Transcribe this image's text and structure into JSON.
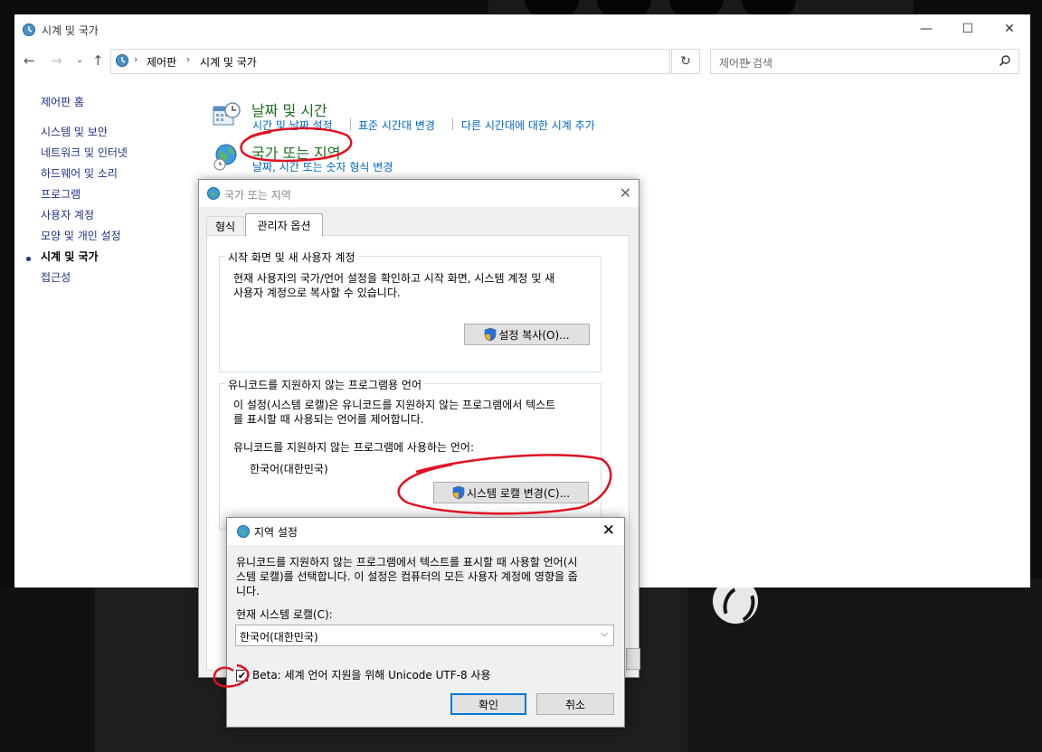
{
  "window": {
    "title": "시계 및 국가",
    "buttons": {
      "minimize": "—",
      "maximize": "☐",
      "close": "✕"
    }
  },
  "address": {
    "crumbs": [
      "제어판",
      "시계 및 국가"
    ],
    "search_placeholder": "제어판 검색"
  },
  "sidebar": {
    "home": "제어판 홈",
    "items": [
      "시스템 및 보안",
      "네트워크 및 인터넷",
      "하드웨어 및 소리",
      "프로그램",
      "사용자 계정",
      "모양 및 개인 설정",
      "시계 및 국가",
      "접근성"
    ]
  },
  "categories": {
    "datetime": {
      "title": "날짜 및 시간",
      "links": [
        "시간 및 날짜 설정",
        "표준 시간대 변경",
        "다른 시간대에 대한 시계 추가"
      ]
    },
    "region": {
      "title": "국가 또는 지역",
      "links": [
        "날짜, 시간 또는 숫자 형식 변경"
      ]
    }
  },
  "region_dialog": {
    "title": "국가 또는 지역",
    "tabs": [
      "형식",
      "관리자 옵션"
    ],
    "welcome": {
      "title": "시작 화면 및 새 사용자 계정",
      "text1": "현재 사용자의 국가/언어 설정을 확인하고 시작 화면, 시스템 계정 및 새",
      "text2": "사용자 계정으로 복사할 수 있습니다.",
      "button": "설정 복사(O)..."
    },
    "unicode": {
      "title": "유니코드를 지원하지 않는 프로그램용 언어",
      "text1": "이 설정(시스템 로캘)은 유니코드를 지원하지 않는 프로그램에서 텍스트",
      "text2": "를 표시할 때 사용되는 언어를 제어합니다.",
      "label": "유니코드를 지원하지 않는 프로그램에 사용하는 언어:",
      "current": "한국어(대한민국)",
      "button": "시스템 로캘 변경(C)..."
    }
  },
  "locale_dialog": {
    "title": "지역 설정",
    "desc1": "유니코드를 지원하지 않는 프로그램에서 텍스트를 표시할 때 사용할 언어(시",
    "desc2": "스템 로캘)를 선택합니다. 이 설정은 컴퓨터의 모든 사용자 계정에 영향을 줍",
    "desc3": "니다.",
    "combo_label": "현재 시스템 로캘(C):",
    "combo_value": "한국어(대한민국)",
    "beta_label": "Beta: 세계 언어 지원을 위해 Unicode UTF-8 사용",
    "beta_checked": true,
    "ok": "확인",
    "cancel": "취소"
  },
  "colors": {
    "link": "#0066cc",
    "category_title": "#1e6e1e",
    "annotation": "#e01020"
  }
}
